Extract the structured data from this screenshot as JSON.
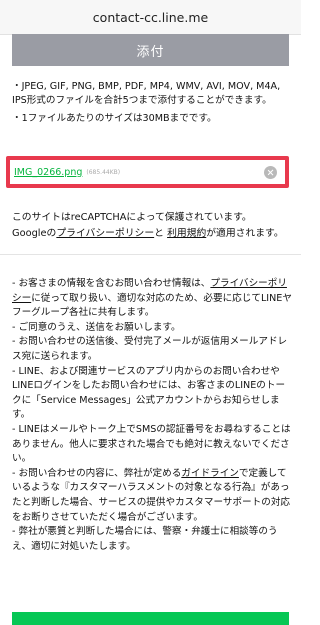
{
  "browser": {
    "url": "contact-cc.line.me"
  },
  "attach": {
    "label": "添付"
  },
  "notes": [
    "JPEG, GIF, PNG, BMP, PDF, MP4, WMV, AVI, MOV, M4A, IPS形式のファイルを合計5つまで添付することができます。",
    "1ファイルあたりのサイズは30MBまでです。"
  ],
  "file": {
    "name": "IMG_0266.png",
    "size": "(685.44KB)"
  },
  "recaptcha": {
    "text1": "このサイトはreCAPTCHAによって保護されています。",
    "prefix": "Googleの",
    "privacy_link": "プライバシーポリシー",
    "and": "と",
    "terms_link": "利用規約",
    "suffix": "が適用されます。"
  },
  "info": {
    "p1_a": "- お客さまの情報を含むお問い合わせ情報は、",
    "p1_link": "プライバシーポリシー",
    "p1_b": "に従って取り扱い、適切な対応のため、必要に応じてLINEヤフーグループ各社に共有します。",
    "p2": "- ご同意のうえ、送信をお願いします。",
    "p3": "- お問い合わせの送信後、受付完了メールが返信用メールアドレス宛に送られます。",
    "p4": "- LINE、および関連サービスのアプリ内からのお問い合わせやLINEログインをしたお問い合わせには、お客さまのLINEのトークに「Service Messages」公式アカウントからお知らせします。",
    "p5": "- LINEはメールやトーク上でSMSの認証番号をお尋ねすることはありません。他人に要求された場合でも絶対に教えないでください。",
    "p6_a": "- お問い合わせの内容に、弊社が定める",
    "p6_link": "ガイドライン",
    "p6_b": "で定義しているような『カスタマーハラスメントの対象となる行為』があったと判断した場合、サービスの提供やカスタマーサポートの対応をお断りさせていただく場合がございます。",
    "p7": "- 弊社が悪質と判断した場合には、警察・弁護士に相談等のうえ、適切に対処いたします。"
  },
  "colors": {
    "accent_green": "#06c755",
    "highlight_red": "#e8394d",
    "button_gray": "#9a9ca4"
  }
}
